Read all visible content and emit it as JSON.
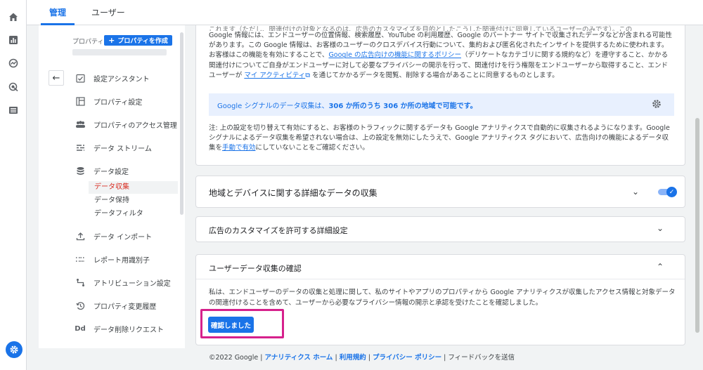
{
  "tabs": {
    "admin": "管理",
    "users": "ユーザー"
  },
  "property": {
    "label": "プロパティ",
    "create_button": "プロパティを作成"
  },
  "nav": {
    "items": [
      {
        "label": "設定アシスタント",
        "icon": "checklist-icon"
      },
      {
        "label": "プロパティ設定",
        "icon": "layout-icon"
      },
      {
        "label": "プロパティのアクセス管理",
        "icon": "people-icon"
      },
      {
        "label": "データ ストリーム",
        "icon": "streams-icon"
      },
      {
        "label": "データ設定",
        "icon": "database-icon"
      }
    ],
    "sub_items": [
      {
        "label": "データ収集",
        "active": true
      },
      {
        "label": "データ保持",
        "active": false
      },
      {
        "label": "データフィルタ",
        "active": false
      }
    ],
    "items2": [
      {
        "label": "データ インポート",
        "icon": "upload-icon"
      },
      {
        "label": "レポート用識別子",
        "icon": "identifier-icon"
      },
      {
        "label": "アトリビューション設定",
        "icon": "attribution-icon"
      },
      {
        "label": "プロパティ変更履歴",
        "icon": "history-icon"
      },
      {
        "label": "データ削除リクエスト",
        "icon": "dd-icon"
      }
    ]
  },
  "signals": {
    "top_line": "これます（ただし、関連付けの対象となるのは、広告のカスタマイズを目的としたこうした関連付けに同意しているユーザーのみです）。この",
    "para1": "Google 情報には、エンドユーザーの位置情報、検索履歴、YouTube の利用履歴、Google のパートナー サイトで収集されたデータなどが含まれる可能性があります。この Google 情報は、お客様のユーザーのクロスデバイス行動について、集約および匿名化されたインサイトを提供するために使われます。お客様はこの機能を有効にすることで、",
    "policy_link": "Google の広告向けの機能に関するポリシー",
    "para2": "（デリケートなカテゴリに関する規約など）を遵守すること、かかる関連付けについてご自身がエンドユーザーに対して必要なプライバシーの開示を行って、関連付けを行う権限をエンドユーザーから取得すること、エンドユーザーが",
    "activity_link": "マイ アクティビティ",
    "para3": "を通じてかかるデータを閲覧、削除する場合があることに同意するものとします。",
    "banner_prefix": "Google シグナルのデータ収集は、",
    "banner_bold": "306 か所のうち 306 か所の地域で可能です。",
    "note1": "注: 上の設定を切り替えて有効にすると、お客様のトラフィックに関するデータも Google アナリティクスで自動的に収集されるようになります。Google シグナルによるデータ収集を希望されない場合は、上の設定を無効にしたうえで、Google アナリティクス タグにおいて、広告向けの機能によるデータ収集を",
    "manual_link": "手動で有効",
    "note2": "にしていないことをご確認ください。"
  },
  "sections": {
    "region": {
      "title": "地域とデバイスに関する詳細なデータの収集",
      "toggle_on": true
    },
    "ads": {
      "title": "広告のカスタマイズを許可する詳細設定"
    },
    "ack": {
      "title": "ユーザーデータ収集の確認",
      "body": "私は、エンドユーザーのデータの収集と処理に関して、私のサイトやアプリのプロパティから Google アナリティクスが収集したアクセス情報と対象データの関連付けることを含めて、ユーザーから必要なプライバシー情報の開示と承認を受けたことを確認しました。",
      "button": "確認しました"
    }
  },
  "footer": {
    "copyright": "©2022 Google",
    "home": "アナリティクス ホーム",
    "terms": "利用規約",
    "privacy": "プライバシー ポリシー",
    "feedback": "フィードバックを送信"
  },
  "colors": {
    "accent": "#1a73e8",
    "highlight": "#d6218c",
    "active_nav": "#d93025"
  }
}
